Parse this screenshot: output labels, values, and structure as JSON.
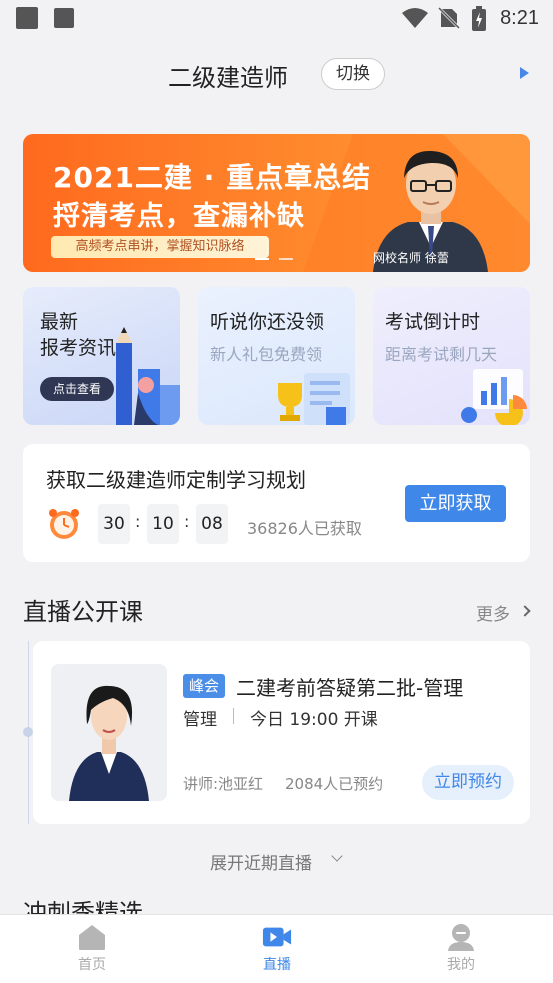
{
  "status_bar": {
    "time": "8:21"
  },
  "header": {
    "title": "二级建造师",
    "switch_label": "切换"
  },
  "banner": {
    "line1": "2021二建 · 重点章总结",
    "line2": "捋清考点，查漏补缺",
    "tag": "高频考点串讲，掌握知识脉络",
    "teacher_label": "网校名师  徐蕾"
  },
  "cards": [
    {
      "title_line1": "最新",
      "title_line2": "报考资讯",
      "button": "点击查看"
    },
    {
      "title": "听说你还没领",
      "subtitle": "新人礼包免费领"
    },
    {
      "title": "考试倒计时",
      "subtitle": "距离考试剩几天"
    }
  ],
  "plan": {
    "title": "获取二级建造师定制学习规划",
    "countdown": {
      "h": "30",
      "m": "10",
      "s": "08"
    },
    "count_text": "36826人已获取",
    "button": "立即获取"
  },
  "live_section": {
    "title": "直播公开课",
    "more": "更多",
    "course": {
      "tag": "峰会",
      "title": "二建考前答疑第二批-管理",
      "subject": "管理",
      "time": "今日 19:00 开课",
      "teacher": "讲师:池亚红",
      "reserved": "2084人已预约",
      "button": "立即预约"
    },
    "expand": "展开近期直播"
  },
  "next_section_title": "冲刺季精选",
  "nav": {
    "home": "首页",
    "live": "直播",
    "mine": "我的"
  },
  "colors": {
    "accent": "#3f87e8",
    "banner": "#ff6a1e"
  }
}
